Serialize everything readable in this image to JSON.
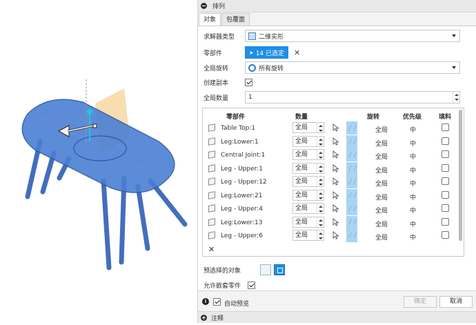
{
  "dialog": {
    "title": "排列"
  },
  "tabs": [
    {
      "label": "对象"
    },
    {
      "label": "包覆面"
    }
  ],
  "solver_type": {
    "label": "求解器类型",
    "value": "二维实形"
  },
  "components": {
    "label": "零部件",
    "selection": "14 已选定"
  },
  "global_rotation": {
    "label": "全局旋转",
    "value": "所有旋转"
  },
  "create_copies": {
    "label": "创建副本",
    "checked": true
  },
  "global_quantity": {
    "label": "全局数量",
    "value": "1"
  },
  "table": {
    "headers": {
      "component": "零部件",
      "quantity": "数量",
      "rotation": "旋转",
      "priority": "优先级",
      "fill": "填料"
    },
    "rows": [
      {
        "name": "Table Top:1",
        "qty": "全局",
        "rotation": "全局",
        "priority": "中"
      },
      {
        "name": "Leg:Lower:1",
        "qty": "全局",
        "rotation": "全局",
        "priority": "中"
      },
      {
        "name": "Central Joint:1",
        "qty": "全局",
        "rotation": "全局",
        "priority": "中"
      },
      {
        "name": "Leg - Upper:1",
        "qty": "全局",
        "rotation": "全局",
        "priority": "中"
      },
      {
        "name": "Leg - Upper:12",
        "qty": "全局",
        "rotation": "全局",
        "priority": "中"
      },
      {
        "name": "Leg:Lower:21",
        "qty": "全局",
        "rotation": "全局",
        "priority": "中"
      },
      {
        "name": "Leg - Upper:4",
        "qty": "全局",
        "rotation": "全局",
        "priority": "中"
      },
      {
        "name": "Leg:Lower:13",
        "qty": "全局",
        "rotation": "全局",
        "priority": "中"
      },
      {
        "name": "Leg - Upper:6",
        "qty": "全局",
        "rotation": "全局",
        "priority": "中"
      }
    ]
  },
  "preselected": {
    "label": "预选择的对象"
  },
  "allow_nested": {
    "label": "允许嵌套零件",
    "checked": true
  },
  "footer": {
    "auto_preview": "自动预览",
    "ok": "确定",
    "cancel": "取消"
  },
  "notes": {
    "label": "注释"
  },
  "colors": {
    "accent": "#1e8ee6",
    "model": "#3f72c9",
    "plane": "#f6d49a"
  }
}
